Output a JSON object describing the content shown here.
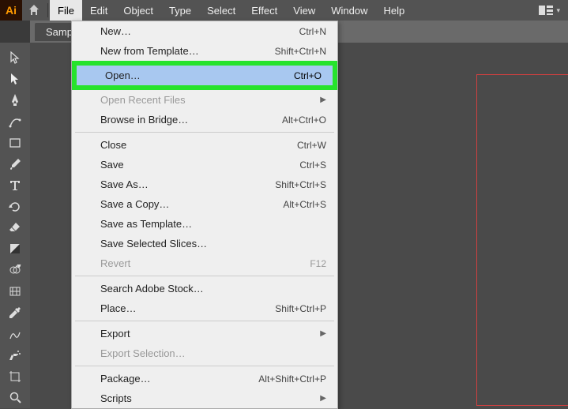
{
  "app": {
    "icon_text": "Ai"
  },
  "menubar": {
    "items": [
      "File",
      "Edit",
      "Object",
      "Type",
      "Select",
      "Effect",
      "View",
      "Window",
      "Help"
    ],
    "active_index": 0
  },
  "doc": {
    "tab": "Sampl"
  },
  "file_menu": [
    {
      "type": "item",
      "label": "New…",
      "shortcut": "Ctrl+N"
    },
    {
      "type": "item",
      "label": "New from Template…",
      "shortcut": "Shift+Ctrl+N"
    },
    {
      "type": "highlighted",
      "label": "Open…",
      "shortcut": "Ctrl+O"
    },
    {
      "type": "item",
      "label": "Open Recent Files",
      "submenu": true,
      "disabled": true
    },
    {
      "type": "item",
      "label": "Browse in Bridge…",
      "shortcut": "Alt+Ctrl+O"
    },
    {
      "type": "sep"
    },
    {
      "type": "item",
      "label": "Close",
      "shortcut": "Ctrl+W"
    },
    {
      "type": "item",
      "label": "Save",
      "shortcut": "Ctrl+S"
    },
    {
      "type": "item",
      "label": "Save As…",
      "shortcut": "Shift+Ctrl+S"
    },
    {
      "type": "item",
      "label": "Save a Copy…",
      "shortcut": "Alt+Ctrl+S"
    },
    {
      "type": "item",
      "label": "Save as Template…"
    },
    {
      "type": "item",
      "label": "Save Selected Slices…"
    },
    {
      "type": "item",
      "label": "Revert",
      "shortcut": "F12",
      "disabled": true
    },
    {
      "type": "sep"
    },
    {
      "type": "item",
      "label": "Search Adobe Stock…"
    },
    {
      "type": "item",
      "label": "Place…",
      "shortcut": "Shift+Ctrl+P"
    },
    {
      "type": "sep"
    },
    {
      "type": "item",
      "label": "Export",
      "submenu": true
    },
    {
      "type": "item",
      "label": "Export Selection…",
      "disabled": true
    },
    {
      "type": "sep"
    },
    {
      "type": "item",
      "label": "Package…",
      "shortcut": "Alt+Shift+Ctrl+P"
    },
    {
      "type": "item",
      "label": "Scripts",
      "submenu": true
    }
  ],
  "tools": [
    "selection",
    "direct-selection",
    "pen",
    "curvature",
    "rectangle",
    "paintbrush",
    "type",
    "rotate",
    "eraser",
    "gradient",
    "eyedropper-alt",
    "mesh",
    "eyedropper",
    "blend",
    "symbol-sprayer",
    "artboard",
    "zoom"
  ]
}
